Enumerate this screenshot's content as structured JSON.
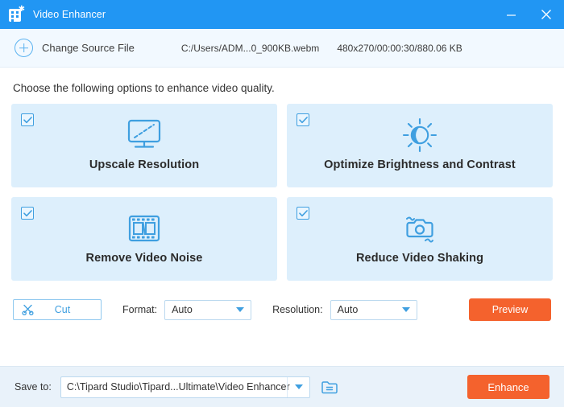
{
  "window": {
    "title": "Video Enhancer",
    "app_icon": "video-enhancer-logo-icon",
    "minimize_label": "—",
    "close_label": "✕",
    "accent_blue": "#2196f3",
    "accent_orange": "#f4622d",
    "card_bg": "#ddeffc"
  },
  "source_bar": {
    "add_icon": "plus-circle-icon",
    "change_label": "Change Source File",
    "file_path": "C:/Users/ADM...0_900KB.webm",
    "file_info": "480x270/00:00:30/880.06 KB"
  },
  "main": {
    "hint": "Choose the following options to enhance video quality.",
    "cards": [
      {
        "label": "Upscale Resolution",
        "icon": "monitor-icon",
        "checked": true
      },
      {
        "label": "Optimize Brightness and Contrast",
        "icon": "sun-brightness-icon",
        "checked": true
      },
      {
        "label": "Remove Video Noise",
        "icon": "film-strip-icon",
        "checked": true
      },
      {
        "label": "Reduce Video Shaking",
        "icon": "camera-shake-icon",
        "checked": true
      }
    ]
  },
  "options": {
    "cut_label": "Cut",
    "cut_icon": "scissors-icon",
    "format_label": "Format:",
    "format_value": "Auto",
    "resolution_label": "Resolution:",
    "resolution_value": "Auto",
    "preview_label": "Preview"
  },
  "bottom": {
    "save_to_label": "Save to:",
    "save_path": "C:\\Tipard Studio\\Tipard...Ultimate\\Video Enhancer",
    "browse_icon": "folder-icon",
    "enhance_label": "Enhance"
  }
}
